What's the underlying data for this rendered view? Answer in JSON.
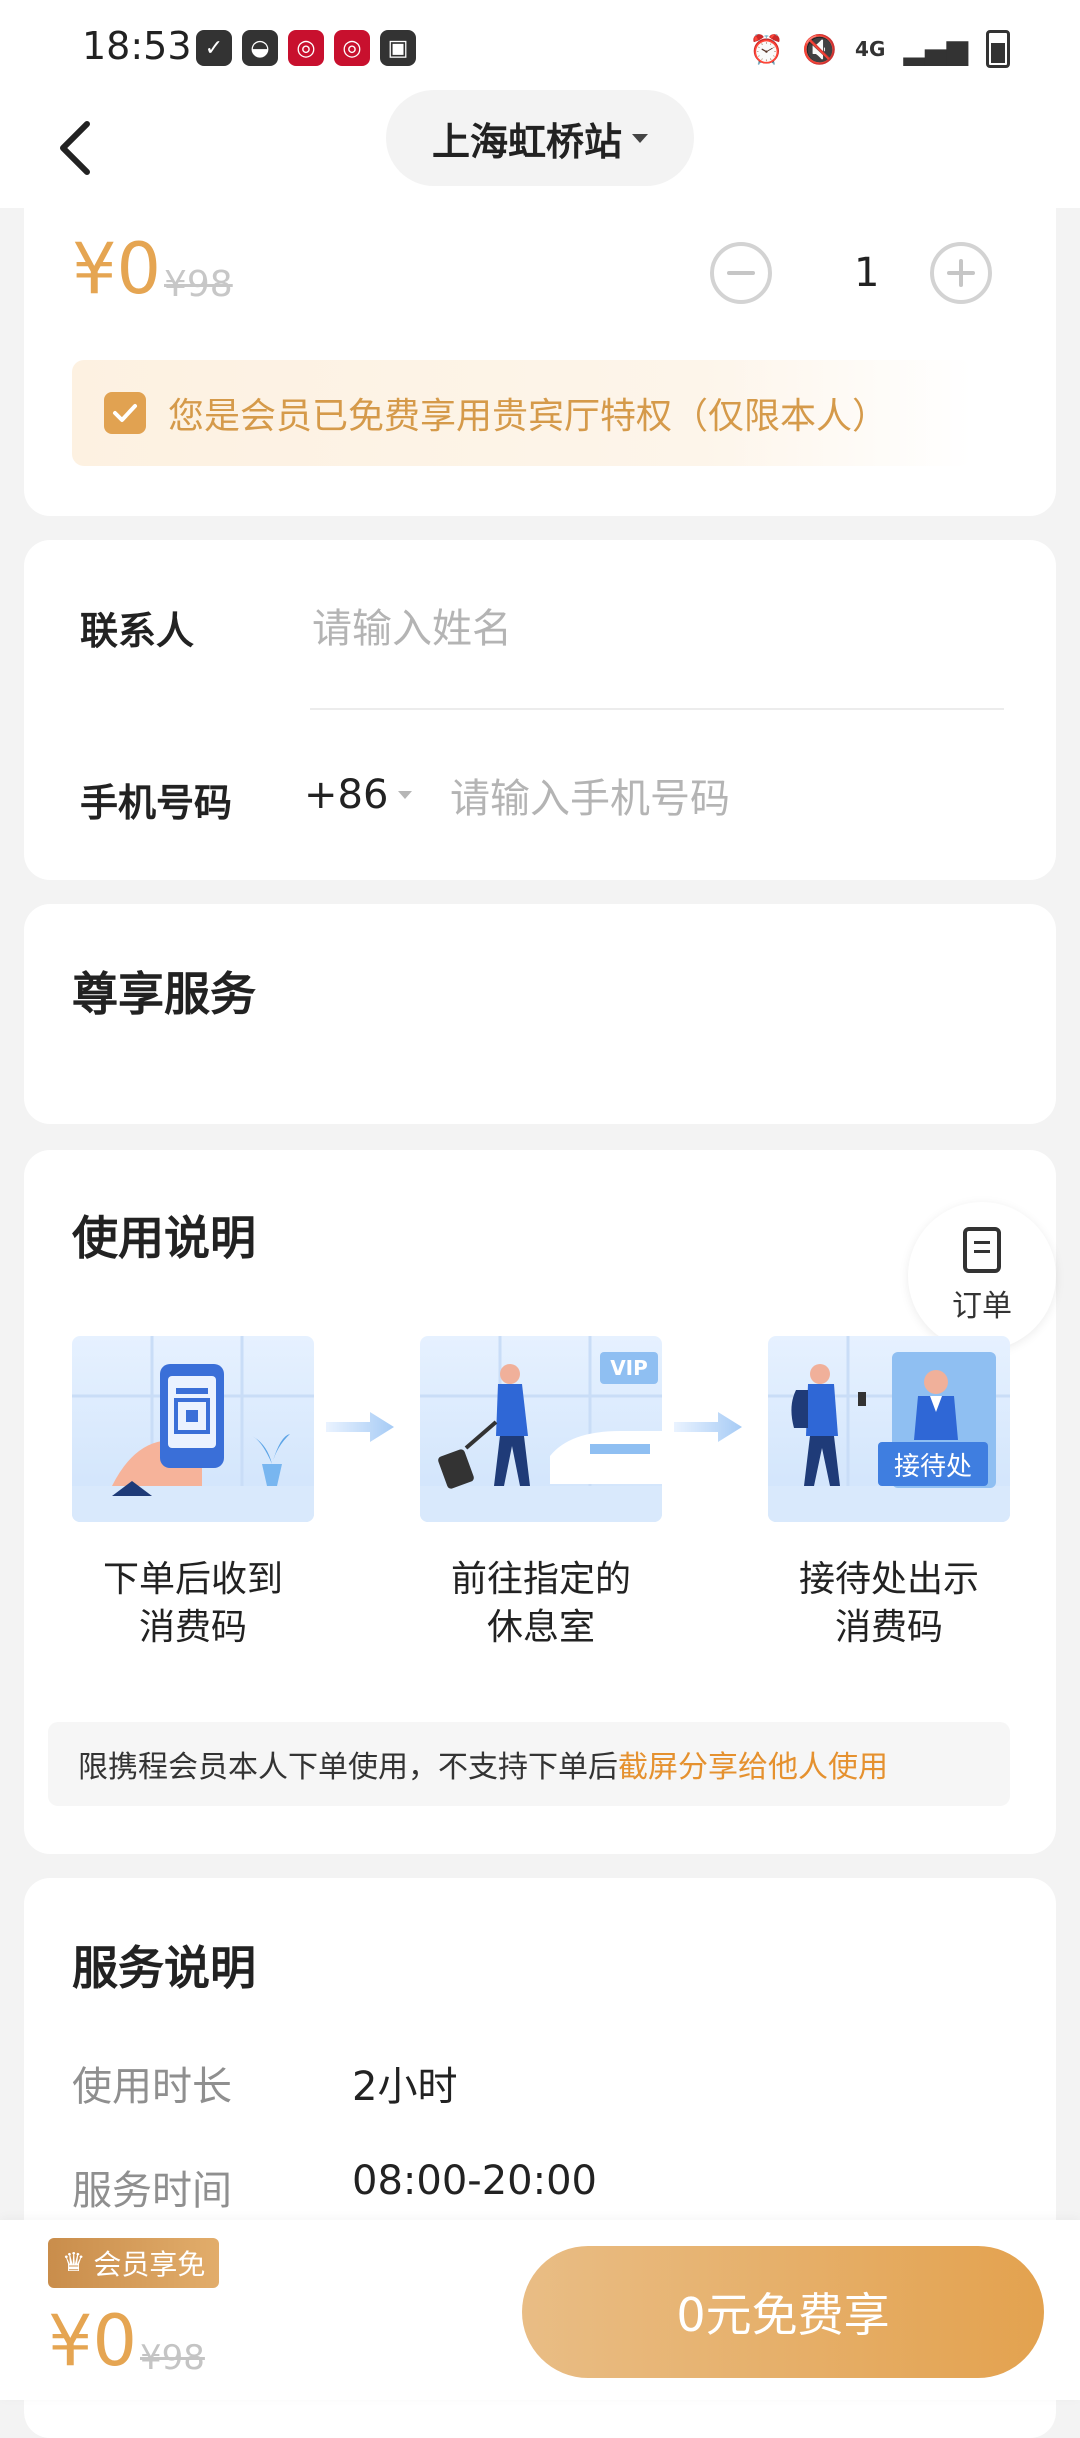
{
  "status_bar": {
    "time": "18:53",
    "network": "4G"
  },
  "header": {
    "station": "上海虹桥站"
  },
  "price_section": {
    "price": "¥0",
    "original_price": "¥98",
    "quantity": "1",
    "member_notice": "您是会员已免费享用贵宾厅特权（仅限本人）"
  },
  "contact": {
    "name_label": "联系人",
    "name_placeholder": "请输入姓名",
    "phone_label": "手机号码",
    "country_code": "+86",
    "phone_placeholder": "请输入手机号码"
  },
  "service": {
    "title": "尊享服务"
  },
  "usage": {
    "title": "使用说明",
    "order_label": "订单",
    "steps": [
      {
        "line1": "下单后收到",
        "line2": "消费码"
      },
      {
        "line1": "前往指定的",
        "line2": "休息室"
      },
      {
        "line1": "接待处出示",
        "line2": "消费码"
      }
    ],
    "vip_badge": "VIP",
    "reception_badge": "接待处",
    "notice_text": "限携程会员本人下单使用，不支持下单后",
    "notice_highlight": "截屏分享给他人使用"
  },
  "service_desc": {
    "title": "服务说明",
    "rows": [
      {
        "label": "使用时长",
        "value": "2小时"
      },
      {
        "label": "服务时间",
        "value": "08:00-20:00"
      }
    ]
  },
  "bottom_bar": {
    "member_tag": "会员享免",
    "price": "¥0",
    "original_price": "¥98",
    "cta_label": "0元免费享"
  },
  "colors": {
    "accent": "#E5A552",
    "highlight": "#E5912F",
    "illustration_blue": "#CFE3FB"
  }
}
